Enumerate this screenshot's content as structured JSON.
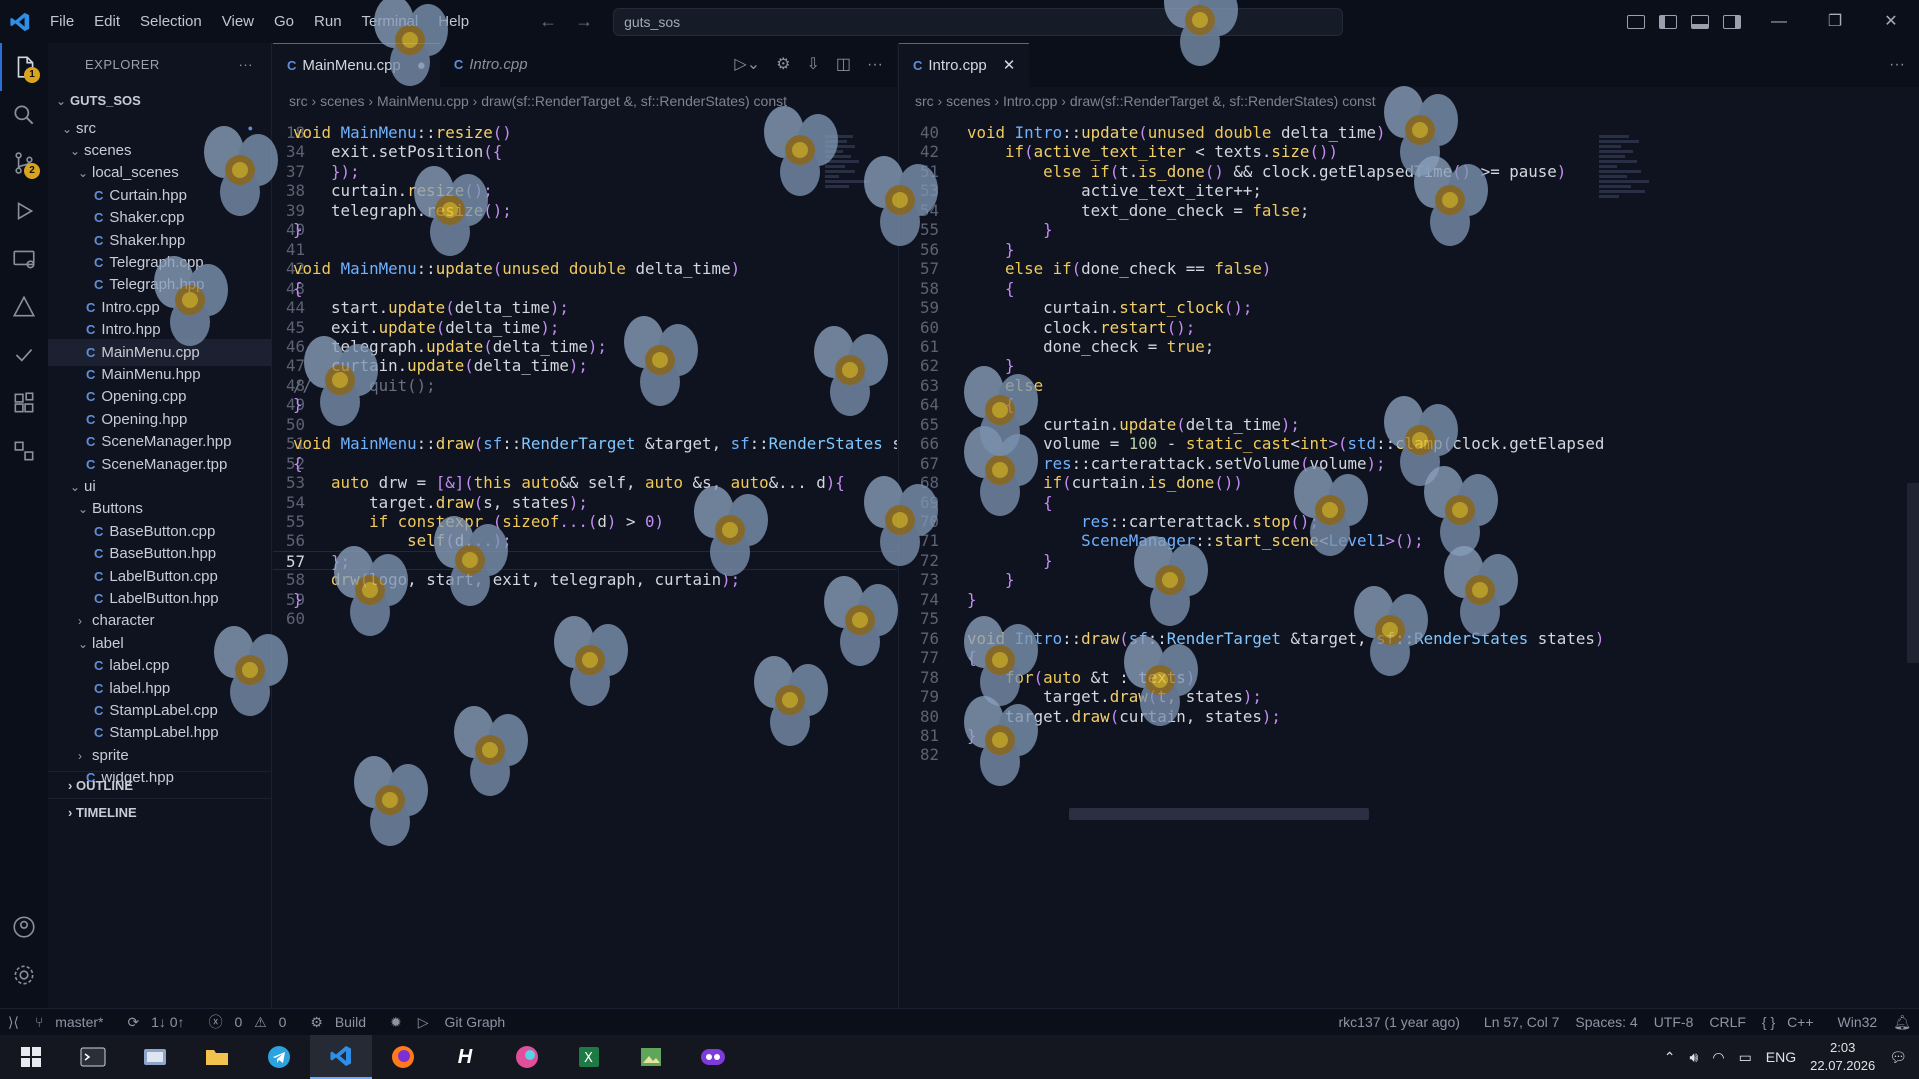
{
  "titlebar": {
    "menus": [
      "File",
      "Edit",
      "Selection",
      "View",
      "Go",
      "Run",
      "Terminal",
      "Help"
    ],
    "search": "guts_sos"
  },
  "activity": {
    "explorer_badge": "1",
    "scm_badge": "2"
  },
  "sidebar": {
    "title": "EXPLORER",
    "project": "GUTS_SOS",
    "items": [
      {
        "label": "src",
        "kind": "folder",
        "depth": 1,
        "open": true
      },
      {
        "label": "scenes",
        "kind": "folder",
        "depth": 2,
        "open": true
      },
      {
        "label": "local_scenes",
        "kind": "folder",
        "depth": 3,
        "open": true
      },
      {
        "label": "Curtain.hpp",
        "kind": "file",
        "depth": 4
      },
      {
        "label": "Shaker.cpp",
        "kind": "file",
        "depth": 4
      },
      {
        "label": "Shaker.hpp",
        "kind": "file",
        "depth": 4
      },
      {
        "label": "Telegraph.cpp",
        "kind": "file",
        "depth": 4
      },
      {
        "label": "Telegraph.hpp",
        "kind": "file",
        "depth": 4
      },
      {
        "label": "Intro.cpp",
        "kind": "file",
        "depth": 3
      },
      {
        "label": "Intro.hpp",
        "kind": "file",
        "depth": 3
      },
      {
        "label": "MainMenu.cpp",
        "kind": "file",
        "depth": 3,
        "selected": true
      },
      {
        "label": "MainMenu.hpp",
        "kind": "file",
        "depth": 3
      },
      {
        "label": "Opening.cpp",
        "kind": "file",
        "depth": 3
      },
      {
        "label": "Opening.hpp",
        "kind": "file",
        "depth": 3
      },
      {
        "label": "SceneManager.hpp",
        "kind": "file",
        "depth": 3
      },
      {
        "label": "SceneManager.tpp",
        "kind": "file",
        "depth": 3
      },
      {
        "label": "ui",
        "kind": "folder",
        "depth": 2,
        "open": true
      },
      {
        "label": "Buttons",
        "kind": "folder",
        "depth": 3,
        "open": true
      },
      {
        "label": "BaseButton.cpp",
        "kind": "file",
        "depth": 4
      },
      {
        "label": "BaseButton.hpp",
        "kind": "file",
        "depth": 4
      },
      {
        "label": "LabelButton.cpp",
        "kind": "file",
        "depth": 4
      },
      {
        "label": "LabelButton.hpp",
        "kind": "file",
        "depth": 4
      },
      {
        "label": "character",
        "kind": "folder",
        "depth": 3,
        "open": false
      },
      {
        "label": "label",
        "kind": "folder",
        "depth": 3,
        "open": true
      },
      {
        "label": "label.cpp",
        "kind": "file",
        "depth": 4
      },
      {
        "label": "label.hpp",
        "kind": "file",
        "depth": 4
      },
      {
        "label": "StampLabel.cpp",
        "kind": "file",
        "depth": 4
      },
      {
        "label": "StampLabel.hpp",
        "kind": "file",
        "depth": 4
      },
      {
        "label": "sprite",
        "kind": "folder",
        "depth": 3,
        "open": false
      },
      {
        "label": "widget.hpp",
        "kind": "file",
        "depth": 3
      }
    ],
    "outline": "OUTLINE",
    "timeline": "TIMELINE"
  },
  "left_editor": {
    "tabs": [
      {
        "label": "MainMenu.cpp",
        "active": true,
        "dirty": true
      },
      {
        "label": "Intro.cpp",
        "active": false,
        "italic": true
      }
    ],
    "breadcrumb": [
      "src",
      "scenes",
      "MainMenu.cpp",
      "draw(sf::RenderTarget &, sf::RenderStates) const"
    ],
    "lines": [
      {
        "n": "18",
        "t": "void MainMenu::resize()"
      },
      {
        "n": "34",
        "t": "    exit.setPosition({"
      },
      {
        "n": "37",
        "t": "    });"
      },
      {
        "n": "38",
        "t": "    curtain.resize();"
      },
      {
        "n": "39",
        "t": "    telegraph.resize();"
      },
      {
        "n": "40",
        "t": "}"
      },
      {
        "n": "41",
        "t": ""
      },
      {
        "n": "42",
        "t": "void MainMenu::update(unused double delta_time)"
      },
      {
        "n": "43",
        "t": "{"
      },
      {
        "n": "44",
        "t": "    start.update(delta_time);"
      },
      {
        "n": "45",
        "t": "    exit.update(delta_time);"
      },
      {
        "n": "46",
        "t": "    telegraph.update(delta_time);"
      },
      {
        "n": "47",
        "t": "    curtain.update(delta_time);"
      },
      {
        "n": "48",
        "t": "//      quit();"
      },
      {
        "n": "49",
        "t": "}"
      },
      {
        "n": "50",
        "t": ""
      },
      {
        "n": "51",
        "t": "void MainMenu::draw(sf::RenderTarget &target, sf::RenderStates stat"
      },
      {
        "n": "52",
        "t": "{"
      },
      {
        "n": "53",
        "t": "    auto drw = [&](this auto&& self, auto &s, auto&... d){"
      },
      {
        "n": "54",
        "t": "        target.draw(s, states);"
      },
      {
        "n": "55",
        "t": "        if constexpr (sizeof...(d) > 0)"
      },
      {
        "n": "56",
        "t": "            self(d...);"
      },
      {
        "n": "57",
        "t": "    };",
        "current": true
      },
      {
        "n": "58",
        "t": "    drw(logo, start, exit, telegraph, curtain);"
      },
      {
        "n": "59",
        "t": "}"
      },
      {
        "n": "60",
        "t": ""
      }
    ]
  },
  "right_editor": {
    "tabs": [
      {
        "label": "Intro.cpp",
        "active": true
      }
    ],
    "breadcrumb": [
      "src",
      "scenes",
      "Intro.cpp",
      "draw(sf::RenderTarget &, sf::RenderStates) const"
    ],
    "lines": [
      {
        "n": "40",
        "t": "void Intro::update(unused double delta_time)"
      },
      {
        "n": "42",
        "t": "    if(active_text_iter < texts.size())"
      },
      {
        "n": "51",
        "t": "        else if(t.is_done() && clock.getElapsedTime() >= pause)"
      },
      {
        "n": "53",
        "t": "            active_text_iter++;"
      },
      {
        "n": "54",
        "t": "            text_done_check = false;"
      },
      {
        "n": "55",
        "t": "        }"
      },
      {
        "n": "56",
        "t": "    }"
      },
      {
        "n": "57",
        "t": "    else if(done_check == false)"
      },
      {
        "n": "58",
        "t": "    {"
      },
      {
        "n": "59",
        "t": "        curtain.start_clock();"
      },
      {
        "n": "60",
        "t": "        clock.restart();"
      },
      {
        "n": "61",
        "t": "        done_check = true;"
      },
      {
        "n": "62",
        "t": "    }"
      },
      {
        "n": "63",
        "t": "    else"
      },
      {
        "n": "64",
        "t": "    {"
      },
      {
        "n": "65",
        "t": "        curtain.update(delta_time);"
      },
      {
        "n": "66",
        "t": "        volume = 100 - static_cast<int>(std::clamp(clock.getElapsed"
      },
      {
        "n": "67",
        "t": "        res::carterattack.setVolume(volume);"
      },
      {
        "n": "68",
        "t": "        if(curtain.is_done())"
      },
      {
        "n": "69",
        "t": "        {"
      },
      {
        "n": "70",
        "t": "            res::carterattack.stop();"
      },
      {
        "n": "71",
        "t": "            SceneManager::start_scene<Level1>();"
      },
      {
        "n": "72",
        "t": "        }"
      },
      {
        "n": "73",
        "t": "    }"
      },
      {
        "n": "74",
        "t": "}"
      },
      {
        "n": "75",
        "t": ""
      },
      {
        "n": "76",
        "t": "void Intro::draw(sf::RenderTarget &target, sf::RenderStates states)"
      },
      {
        "n": "77",
        "t": "{"
      },
      {
        "n": "78",
        "t": "    for(auto &t : texts)"
      },
      {
        "n": "79",
        "t": "        target.draw(t, states);"
      },
      {
        "n": "80",
        "t": "    target.draw(curtain, states);"
      },
      {
        "n": "81",
        "t": "}"
      },
      {
        "n": "82",
        "t": ""
      }
    ]
  },
  "status": {
    "branch": "master*",
    "sync": "1↓ 0↑",
    "errors": "0",
    "warnings": "0",
    "build": "Build",
    "gitgraph": "Git Graph",
    "blame": "rkc137 (1 year ago)",
    "position": "Ln 57, Col 7",
    "spaces": "Spaces: 4",
    "encoding": "UTF-8",
    "eol": "CRLF",
    "language": "C++",
    "platform": "Win32"
  },
  "taskbar": {
    "lang": "ENG",
    "time": "2:03",
    "date": "22.07.2026"
  },
  "colors": {
    "keyword": "#f0c95a",
    "func": "#f4d068",
    "type": "#80c8ff",
    "ns": "#6fb2ff",
    "purple": "#c58cf4",
    "comment": "#6a7080",
    "accent": "#2a6fd1"
  }
}
